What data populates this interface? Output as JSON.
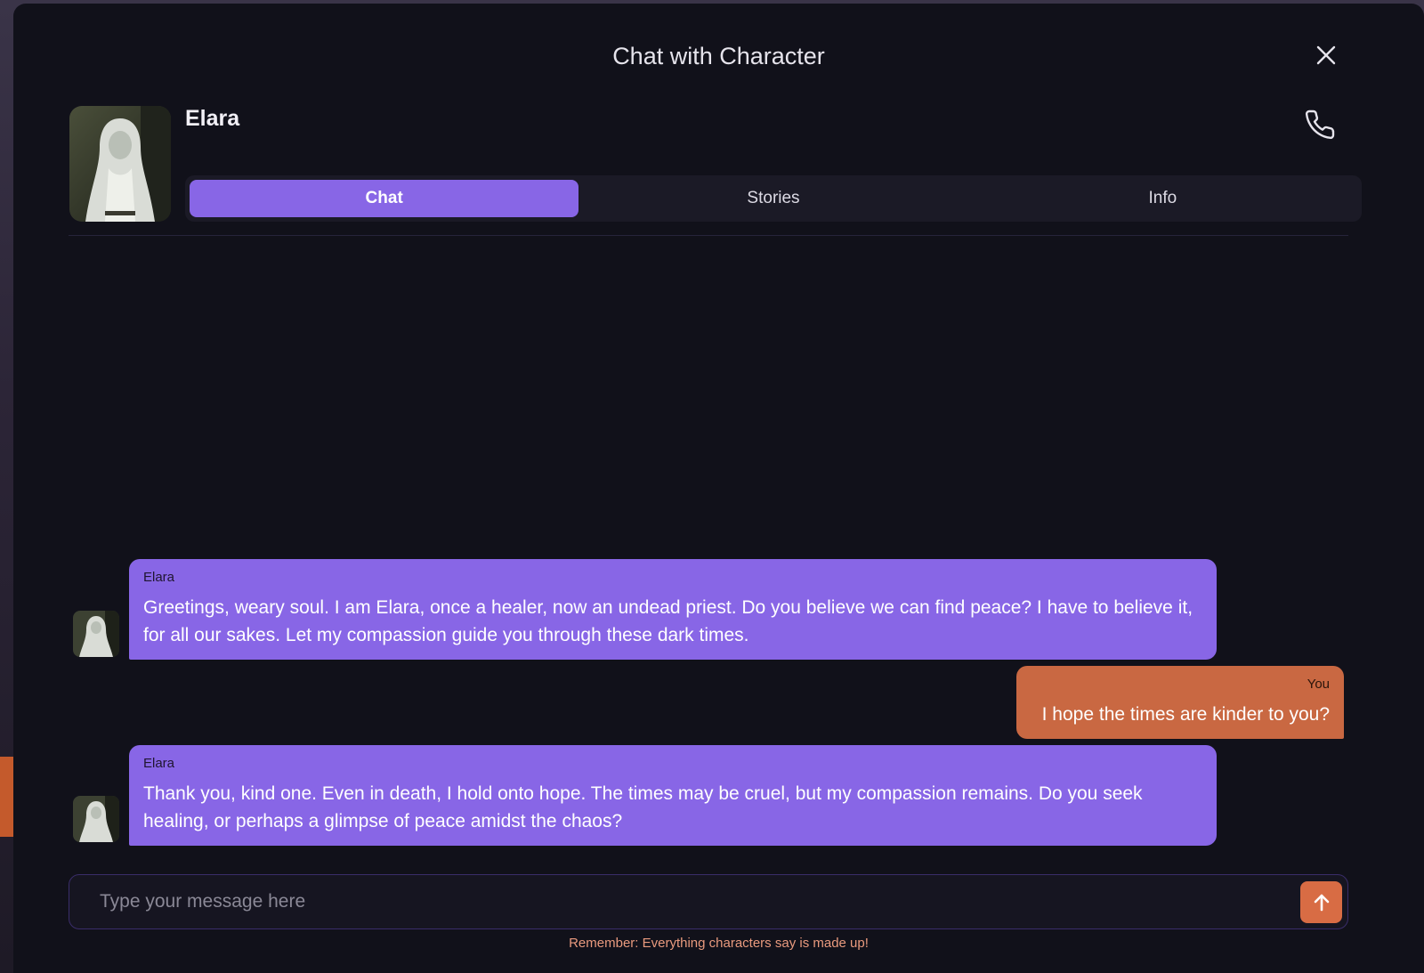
{
  "modal": {
    "title": "Chat with Character"
  },
  "character": {
    "name": "Elara",
    "avatar_icon": "character-portrait"
  },
  "tabs": [
    {
      "label": "Chat",
      "active": true
    },
    {
      "label": "Stories",
      "active": false
    },
    {
      "label": "Info",
      "active": false
    }
  ],
  "messages": [
    {
      "sender": "Elara",
      "role": "character",
      "text": "Greetings, weary soul. I am Elara, once a healer, now an undead priest. Do you believe we can find peace? I have to believe it, for all our sakes. Let my compassion guide you through these dark times."
    },
    {
      "sender": "You",
      "role": "user",
      "text": "I hope the times are kinder to you?"
    },
    {
      "sender": "Elara",
      "role": "character",
      "text": "Thank you, kind one. Even in death, I hold onto hope. The times may be cruel, but my compassion remains. Do you seek healing, or perhaps a glimpse of peace amidst the chaos?"
    }
  ],
  "composer": {
    "placeholder": "Type your message here",
    "value": ""
  },
  "disclaimer": "Remember: Everything characters say is made up!",
  "colors": {
    "background": "#11111a",
    "accent": "#8866e6",
    "user_bubble": "#c96842",
    "send_button": "#d86c44",
    "disclaimer": "#e99a7e"
  },
  "icons": {
    "close": "close-icon",
    "phone": "phone-icon",
    "send": "arrow-up-icon"
  }
}
